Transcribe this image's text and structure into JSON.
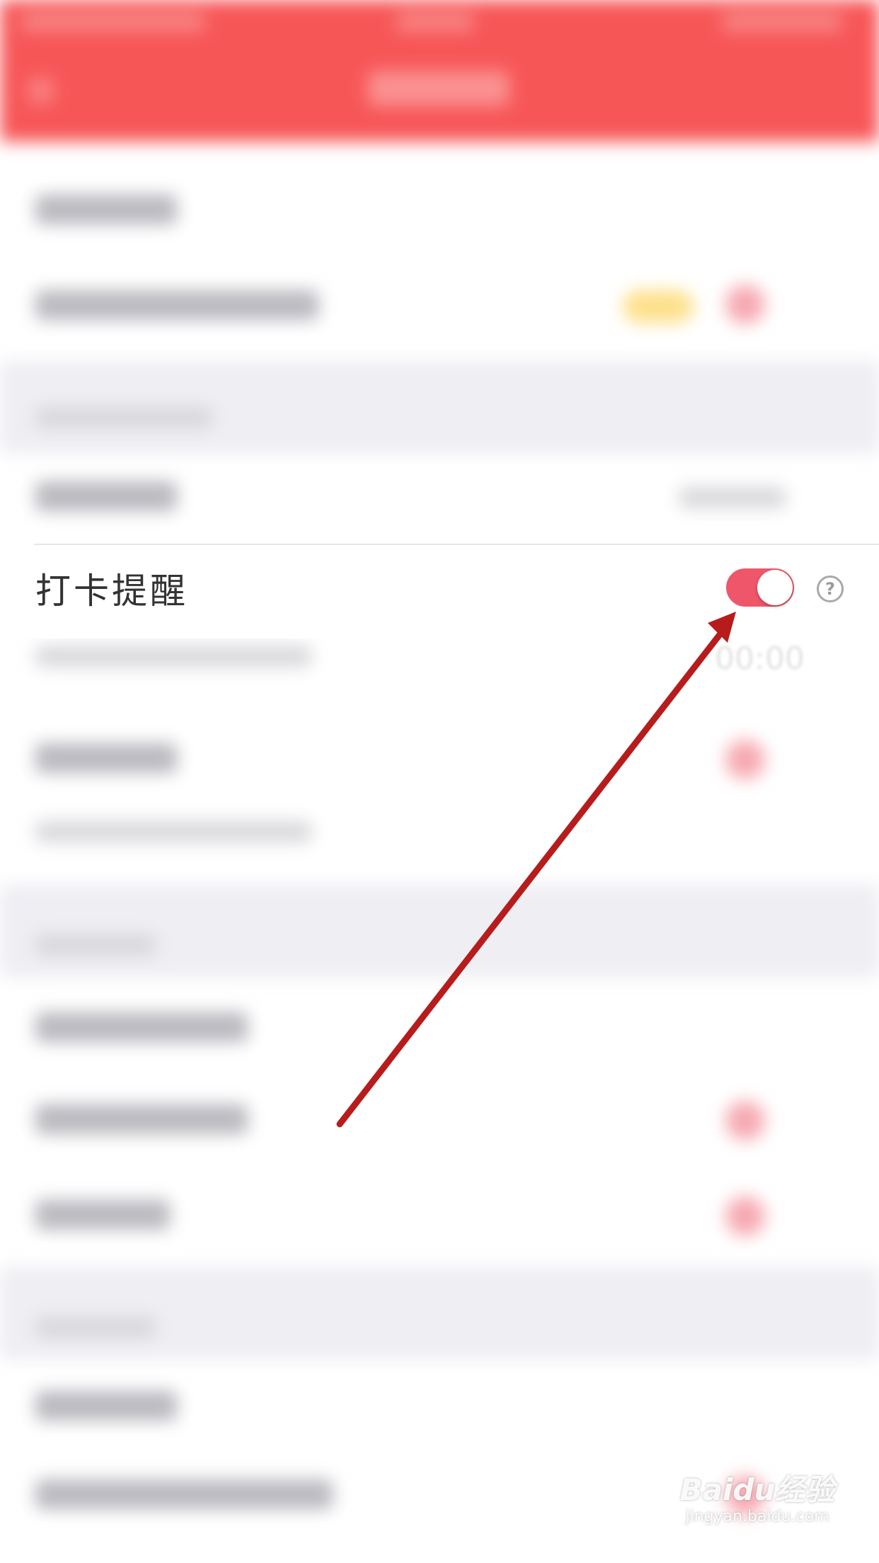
{
  "reminder": {
    "label": "打卡提醒",
    "toggle_on": true,
    "help_glyph": "?",
    "time_text": "00:00"
  },
  "colors": {
    "header": "#f75657",
    "toggle_on": "#f0566a",
    "annotation_arrow": "#b71c1c"
  },
  "icons": {
    "help": "question-circle-icon",
    "annotation": "arrow-annotation"
  },
  "watermark": {
    "main": "Baidu经验",
    "sub": "jingyan.baidu.com"
  }
}
